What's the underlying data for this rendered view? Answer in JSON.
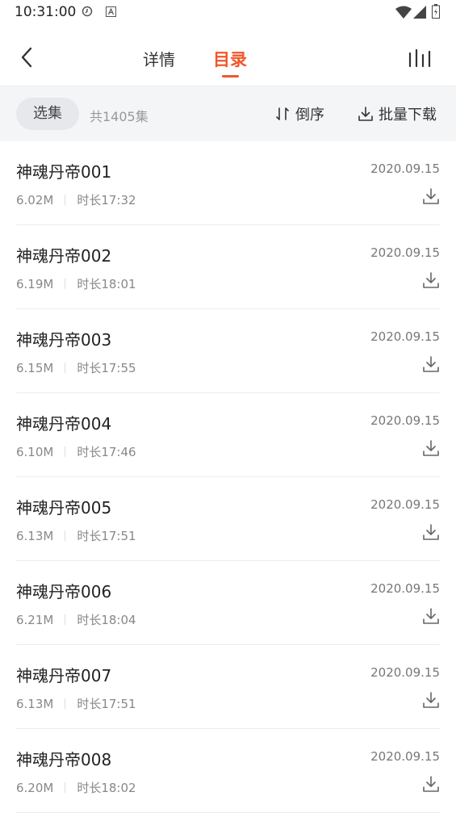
{
  "status": {
    "time": "10:31:00"
  },
  "nav": {
    "tab_detail": "详情",
    "tab_catalog": "目录"
  },
  "toolbar": {
    "select_label": "选集",
    "count_text": "共1405集",
    "sort_label": "倒序",
    "batch_label": "批量下载"
  },
  "episodes": [
    {
      "title": "神魂丹帝001",
      "date": "2020.09.15",
      "size": "6.02M",
      "duration": "时长17:32"
    },
    {
      "title": "神魂丹帝002",
      "date": "2020.09.15",
      "size": "6.19M",
      "duration": "时长18:01"
    },
    {
      "title": "神魂丹帝003",
      "date": "2020.09.15",
      "size": "6.15M",
      "duration": "时长17:55"
    },
    {
      "title": "神魂丹帝004",
      "date": "2020.09.15",
      "size": "6.10M",
      "duration": "时长17:46"
    },
    {
      "title": "神魂丹帝005",
      "date": "2020.09.15",
      "size": "6.13M",
      "duration": "时长17:51"
    },
    {
      "title": "神魂丹帝006",
      "date": "2020.09.15",
      "size": "6.21M",
      "duration": "时长18:04"
    },
    {
      "title": "神魂丹帝007",
      "date": "2020.09.15",
      "size": "6.13M",
      "duration": "时长17:51"
    },
    {
      "title": "神魂丹帝008",
      "date": "2020.09.15",
      "size": "6.20M",
      "duration": "时长18:02"
    }
  ],
  "colors": {
    "accent": "#f0582a",
    "toolbar_bg": "#f4f5f7"
  }
}
